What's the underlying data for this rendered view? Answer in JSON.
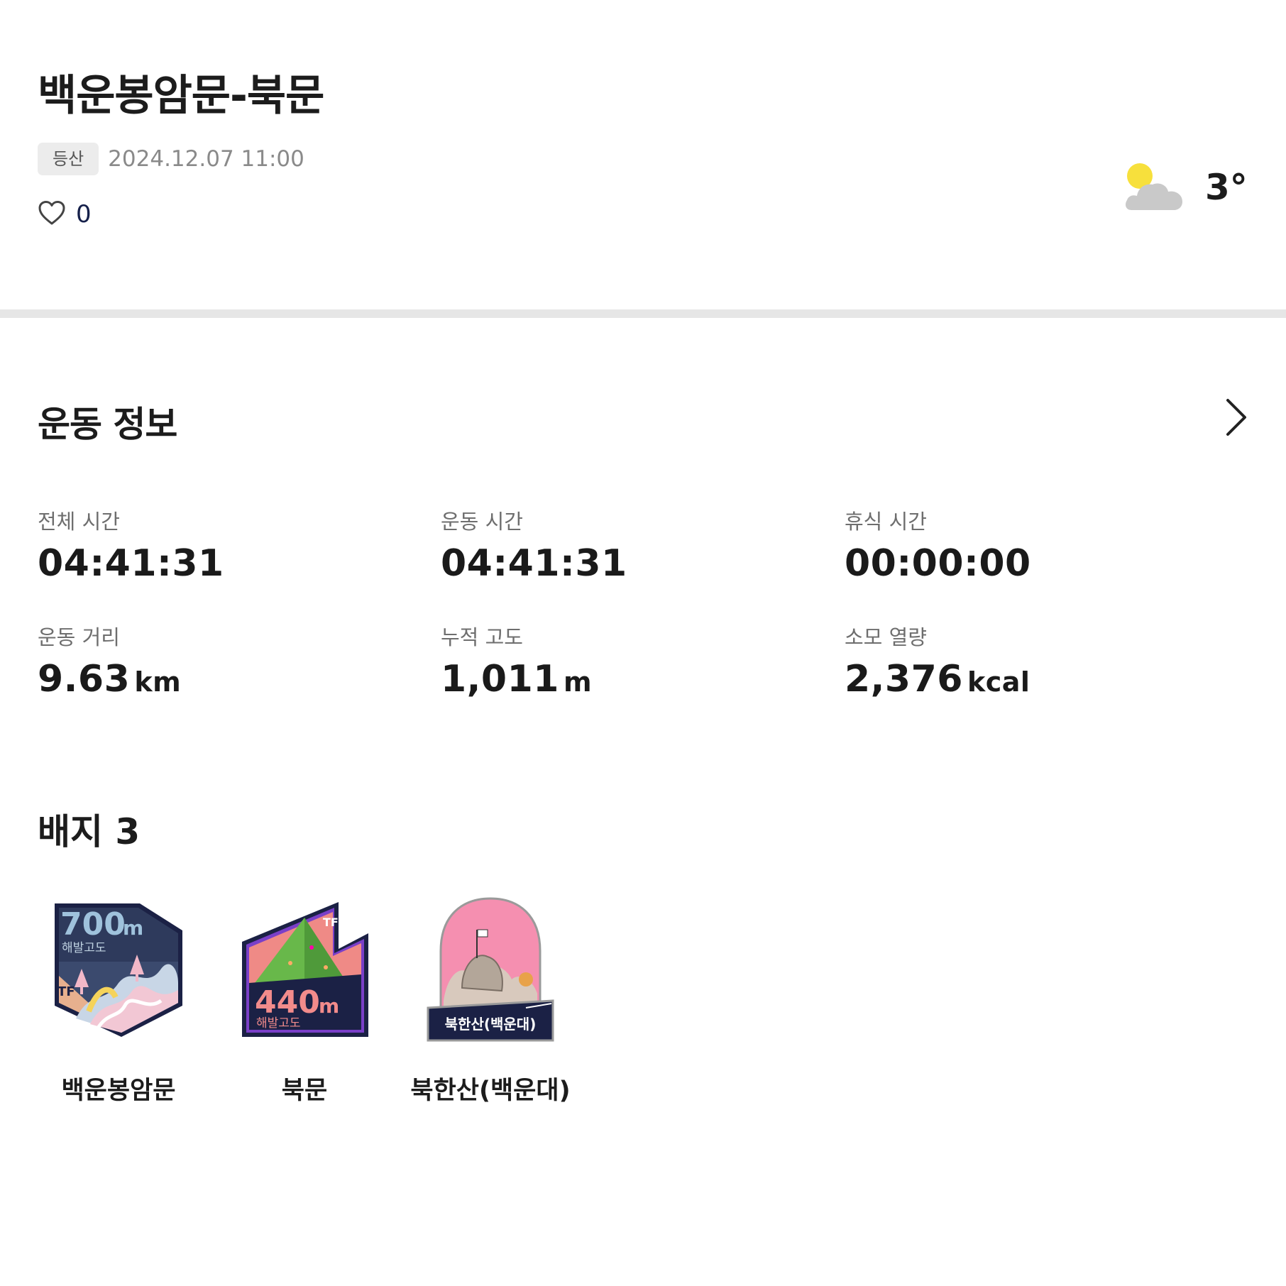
{
  "header": {
    "title": "백운봉암문-북문",
    "tag": "등산",
    "datetime": "2024.12.07 11:00",
    "like_count": "0",
    "weather_icon": "partly-cloudy-icon",
    "temperature": "3°"
  },
  "exercise": {
    "title": "운동 정보",
    "stats": [
      {
        "label": "전체 시간",
        "value": "04:41:31",
        "unit": ""
      },
      {
        "label": "운동 시간",
        "value": "04:41:31",
        "unit": ""
      },
      {
        "label": "휴식 시간",
        "value": "00:00:00",
        "unit": ""
      },
      {
        "label": "운동 거리",
        "value": "9.63",
        "unit": "km"
      },
      {
        "label": "누적 고도",
        "value": "1,011",
        "unit": "m"
      },
      {
        "label": "소모 열량",
        "value": "2,376",
        "unit": "kcal"
      }
    ]
  },
  "badges": {
    "title": "배지 3",
    "items": [
      {
        "name": "백운봉암문",
        "altitude": "700",
        "unit": "m",
        "caption": "해발고도"
      },
      {
        "name": "북문",
        "altitude": "440",
        "unit": "m",
        "caption": "해발고도"
      },
      {
        "name": "북한산(백운대)",
        "banner": "북한산(백운대)"
      }
    ]
  },
  "colors": {
    "navy": "#1b2145",
    "pink": "#f58fb0",
    "purple": "#7a3fc8",
    "sun": "#f7e03c",
    "cloud": "#c9c9c9"
  }
}
